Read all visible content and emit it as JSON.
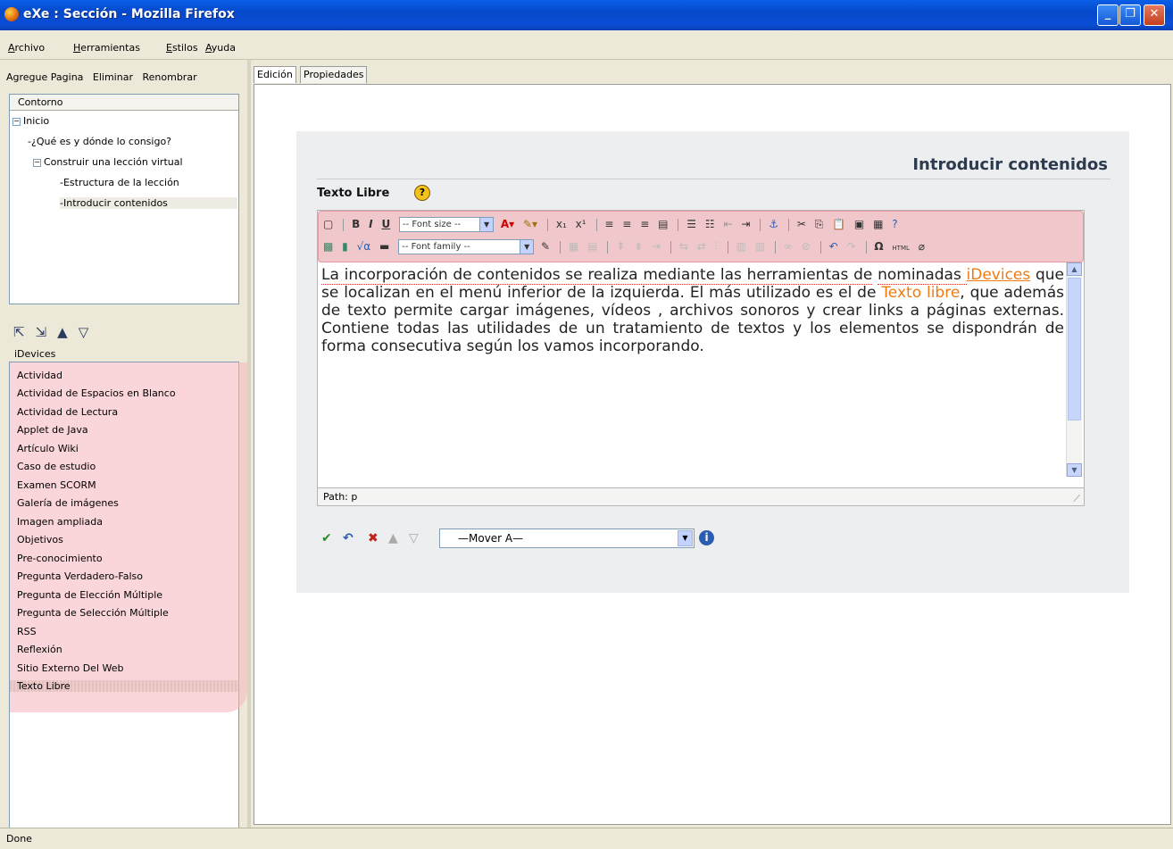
{
  "window": {
    "title": "eXe : Sección - Mozilla Firefox"
  },
  "menu": [
    "Archivo",
    "Herramientas",
    "Estilos",
    "Ayuda"
  ],
  "left_toolbar": [
    "Agregue Pagina",
    "Eliminar",
    "Renombrar"
  ],
  "outline": {
    "header": "Contorno",
    "nodes": [
      "Inicio",
      "¿Qué es y dónde lo consigo?",
      "Construir una lección virtual",
      "Estructura de la lección",
      "Introducir contenidos"
    ]
  },
  "idevices": {
    "header": "iDevices",
    "items": [
      "Actividad",
      "Actividad de Espacios en Blanco",
      "Actividad de Lectura",
      "Applet de Java",
      "Artículo Wiki",
      "Caso de estudio",
      "Examen SCORM",
      "Galería de imágenes",
      "Imagen ampliada",
      "Objetivos",
      "Pre-conocimiento",
      "Pregunta Verdadero-Falso",
      "Pregunta de Elección Múltiple",
      "Pregunta de Selección Múltiple",
      "RSS",
      "Reflexión",
      "Sitio Externo Del Web",
      "Texto Libre"
    ],
    "selected": "Texto Libre"
  },
  "tabs": [
    "Edición",
    "Propiedades"
  ],
  "page_title": "Introducir contenidos",
  "idevice_title": "Texto Libre",
  "toolbar": {
    "font_size": "-- Font size --",
    "font_family": "-- Font family --",
    "html_label": "HTML"
  },
  "editor": {
    "p1": "La incorporación de contenidos se realiza mediante las herramientas de",
    "p2a": "nominadas ",
    "link": "iDevices",
    "p2b": " que se localizan en el menú inferior de la izquierda. El más utilizado es el de ",
    "orange": "Texto libre",
    "p3": ", que además de texto permite cargar imágenes, vídeos , archivos sonoros y crear links a páginas externas. Contiene todas las utilidades de un tratamiento de textos y los elementos se dispondrán de forma consecutiva según los vamos incorporando.",
    "path": "Path: p"
  },
  "move_to": "—Mover A—",
  "status": "Done",
  "colors": {
    "highlight": "#f6b4be",
    "accent_orange": "#f07b12",
    "titlebar": "#0a4ed6"
  }
}
